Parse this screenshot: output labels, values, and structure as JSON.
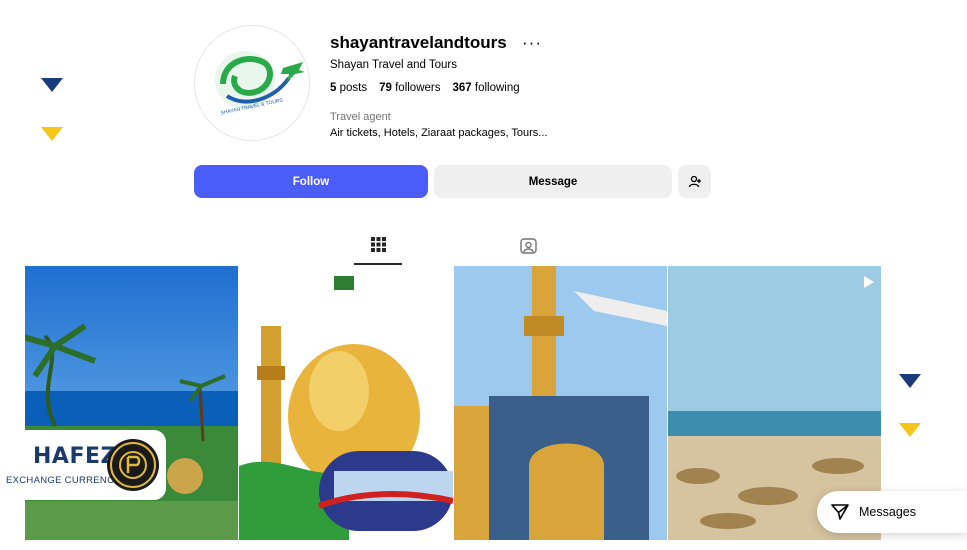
{
  "profile": {
    "username": "shayantravelandtours",
    "more": "···",
    "full_name": "Shayan Travel and Tours",
    "posts_count": "5",
    "posts_label": "posts",
    "followers_count": "79",
    "followers_label": "followers",
    "following_count": "367",
    "following_label": "following",
    "category": "Travel agent",
    "bio": "Air tickets, Hotels, Ziaraat packages, Tours...",
    "logo_text": "SHAYAN TRAVEL & TOURS"
  },
  "actions": {
    "follow_label": "Follow",
    "message_label": "Message"
  },
  "tabs": [
    {
      "name": "posts",
      "icon": "grid-icon"
    },
    {
      "name": "tagged",
      "icon": "tagged-icon"
    }
  ],
  "overlay": {
    "brand_title": "HAFEZ",
    "brand_subtitle": "EXCHANGE CURRENCY",
    "brand_seal_text": "HAFEZ EXCHANGE"
  },
  "messages_button": {
    "label": "Messages"
  },
  "colors": {
    "primary": "#4a5df9",
    "deco_blue": "#1b3a7a",
    "deco_yellow": "#f5c518"
  }
}
